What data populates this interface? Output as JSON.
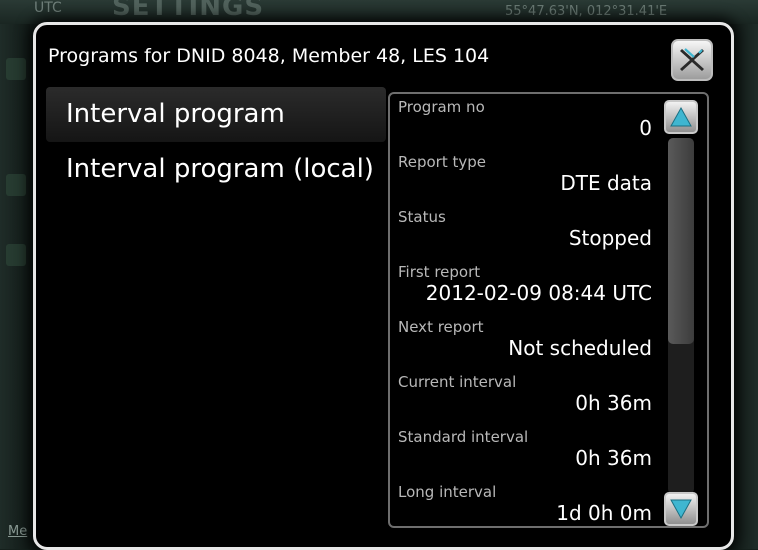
{
  "background": {
    "utc_label": "UTC",
    "title": "SETTINGS",
    "coordinates": "55°47.63'N, 012°31.41'E",
    "bottom_label": "Me"
  },
  "dialog": {
    "title": "Programs for DNID 8048, Member 48, LES 104",
    "close_icon": "close-x-icon",
    "programs": [
      {
        "label": "Interval program",
        "selected": true
      },
      {
        "label": "Interval program (local)",
        "selected": false
      }
    ],
    "details": [
      {
        "label": "Program no",
        "value": "0"
      },
      {
        "label": "Report type",
        "value": "DTE data"
      },
      {
        "label": "Status",
        "value": "Stopped"
      },
      {
        "label": "First report",
        "value": "2012-02-09 08:44 UTC"
      },
      {
        "label": "Next report",
        "value": "Not scheduled"
      },
      {
        "label": "Current interval",
        "value": "0h 36m"
      },
      {
        "label": "Standard interval",
        "value": "0h 36m"
      },
      {
        "label": "Long interval",
        "value": "1d 0h 0m"
      }
    ],
    "scroll_up_icon": "triangle-up-icon",
    "scroll_down_icon": "triangle-down-icon"
  },
  "colors": {
    "accent": "#3fb6d0",
    "border": "#e8e8e8"
  }
}
